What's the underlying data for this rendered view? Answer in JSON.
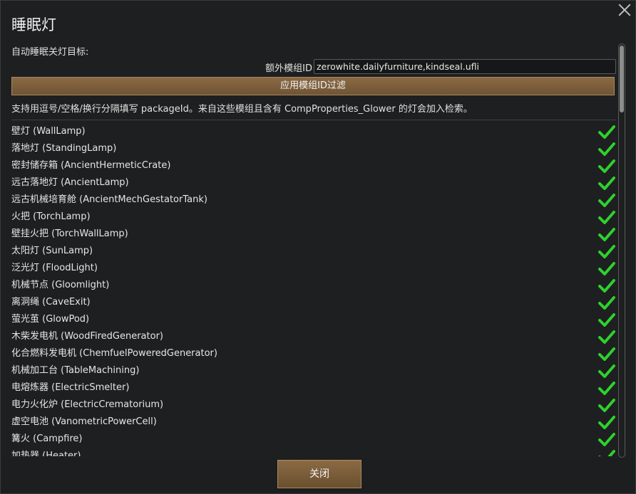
{
  "dialog": {
    "title": "睡眠灯",
    "subtitle": "自动睡眠关灯目标:",
    "filter_label": "额外模组ID",
    "filter_value": "zerowhite.dailyfurniture,kindseal.ufli",
    "apply_button": "应用模组ID过滤",
    "hint": "支持用逗号/空格/换行分隔填写 packageId。来自这些模组且含有 CompProperties_Glower 的灯会加入检索。",
    "close_button": "关闭"
  },
  "items": [
    {
      "label": "壁灯 (WallLamp)",
      "checked": true
    },
    {
      "label": "落地灯 (StandingLamp)",
      "checked": true
    },
    {
      "label": "密封储存箱 (AncientHermeticCrate)",
      "checked": true
    },
    {
      "label": "远古落地灯 (AncientLamp)",
      "checked": true
    },
    {
      "label": "远古机械培育舱 (AncientMechGestatorTank)",
      "checked": true
    },
    {
      "label": "火把 (TorchLamp)",
      "checked": true
    },
    {
      "label": "壁挂火把 (TorchWallLamp)",
      "checked": true
    },
    {
      "label": "太阳灯 (SunLamp)",
      "checked": true
    },
    {
      "label": "泛光灯 (FloodLight)",
      "checked": true
    },
    {
      "label": "机械节点 (Gloomlight)",
      "checked": true
    },
    {
      "label": "离洞绳 (CaveExit)",
      "checked": true
    },
    {
      "label": "萤光茧 (GlowPod)",
      "checked": true
    },
    {
      "label": "木柴发电机 (WoodFiredGenerator)",
      "checked": true
    },
    {
      "label": "化合燃料发电机 (ChemfuelPoweredGenerator)",
      "checked": true
    },
    {
      "label": "机械加工台 (TableMachining)",
      "checked": true
    },
    {
      "label": "电熔炼器 (ElectricSmelter)",
      "checked": true
    },
    {
      "label": "电力火化炉 (ElectricCrematorium)",
      "checked": true
    },
    {
      "label": "虚空电池 (VanometricPowerCell)",
      "checked": true
    },
    {
      "label": "篝火 (Campfire)",
      "checked": true
    },
    {
      "label": "加热器 (Heater)",
      "checked": true
    }
  ],
  "colors": {
    "check": "#2ed12e",
    "button": "#7a5d3b"
  },
  "icons": {
    "close": "close-icon",
    "check": "checkmark-icon"
  }
}
